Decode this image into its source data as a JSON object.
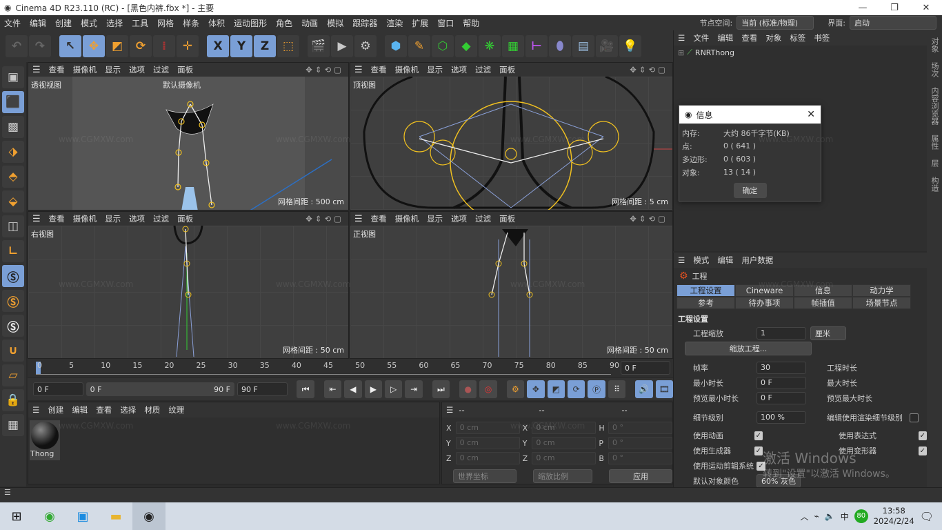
{
  "window": {
    "title": "Cinema 4D R23.110 (RC) - [黑色内裤.fbx *] - 主要",
    "controls": [
      "—",
      "❐",
      "✕"
    ]
  },
  "menu": {
    "items": [
      "文件",
      "编辑",
      "创建",
      "模式",
      "选择",
      "工具",
      "网格",
      "样条",
      "体积",
      "运动图形",
      "角色",
      "动画",
      "模拟",
      "跟踪器",
      "渲染",
      "扩展",
      "窗口",
      "帮助"
    ],
    "node_space_label": "节点空间:",
    "node_space_value": "当前 (标准/物理)",
    "layout_label": "界面:",
    "layout_value": "启动"
  },
  "toolbar": {
    "icons": [
      "undo-icon",
      "redo-icon",
      "select-icon",
      "move-icon",
      "scale-icon",
      "rotate-icon",
      "recent-icon",
      "transform-icon",
      "x-axis-icon",
      "y-axis-icon",
      "z-axis-icon",
      "coord-system-icon",
      "render-view-icon",
      "render-icon",
      "render-settings-icon",
      "cube-icon",
      "pen-icon",
      "subdivision-icon",
      "extrude-icon",
      "array-icon",
      "cloner-icon",
      "deformer-icon",
      "field-icon",
      "floor-icon",
      "camera-icon",
      "light-icon"
    ],
    "xyz": [
      "X",
      "Y",
      "Z"
    ]
  },
  "viewports": [
    {
      "menu": [
        "查看",
        "摄像机",
        "显示",
        "选项",
        "过滤",
        "面板"
      ],
      "label": "透视视图",
      "camera": "默认摄像机",
      "grid": "网格间距 : 500 cm"
    },
    {
      "menu": [
        "查看",
        "摄像机",
        "显示",
        "选项",
        "过滤",
        "面板"
      ],
      "label": "顶视图",
      "grid": "网格间距 : 5 cm"
    },
    {
      "menu": [
        "查看",
        "摄像机",
        "显示",
        "选项",
        "过滤",
        "面板"
      ],
      "label": "右视图",
      "grid": "网格间距 : 50 cm"
    },
    {
      "menu": [
        "查看",
        "摄像机",
        "显示",
        "选项",
        "过滤",
        "面板"
      ],
      "label": "正视图",
      "grid": "网格间距 : 50 cm"
    }
  ],
  "timeline": {
    "ticks": [
      "0",
      "5",
      "10",
      "15",
      "20",
      "25",
      "30",
      "35",
      "40",
      "45",
      "50",
      "55",
      "60",
      "65",
      "70",
      "75",
      "80",
      "85",
      "90"
    ],
    "current": "0 F",
    "current_frame": 0,
    "end": 90
  },
  "transport": {
    "start": "0 F",
    "range_start": "0 F",
    "range_end": "90 F",
    "end": "90 F"
  },
  "material_panel": {
    "menu": [
      "创建",
      "编辑",
      "查看",
      "选择",
      "材质",
      "纹理"
    ],
    "materials": [
      {
        "name": "Thong"
      }
    ]
  },
  "coord_panel": {
    "headers": [
      "--",
      "--",
      "--"
    ],
    "rows": [
      {
        "a": "X",
        "av": "0 cm",
        "b": "X",
        "bv": "0 cm",
        "c": "H",
        "cv": "0 °"
      },
      {
        "a": "Y",
        "av": "0 cm",
        "b": "Y",
        "bv": "0 cm",
        "c": "P",
        "cv": "0 °"
      },
      {
        "a": "Z",
        "av": "0 cm",
        "b": "Z",
        "bv": "0 cm",
        "c": "B",
        "cv": "0 °"
      }
    ],
    "mode": "世界坐标",
    "scale": "缩放比例",
    "apply": "应用"
  },
  "object_manager": {
    "menu": [
      "文件",
      "编辑",
      "查看",
      "对象",
      "标签",
      "书签"
    ],
    "objects": [
      {
        "name": "RNRThong"
      }
    ]
  },
  "info_dialog": {
    "title": "信息",
    "rows": [
      {
        "k": "内存:",
        "v": "大约 86千字节(KB)"
      },
      {
        "k": "点:",
        "v": "0 ( 641 )"
      },
      {
        "k": "多边形:",
        "v": "0 ( 603 )"
      },
      {
        "k": "对象:",
        "v": "13 ( 14 )"
      }
    ],
    "ok": "确定"
  },
  "attributes": {
    "menu": [
      "模式",
      "编辑",
      "用户数据"
    ],
    "object": "工程",
    "tabs": [
      "工程设置",
      "Cineware",
      "信息",
      "动力学",
      "参考",
      "待办事项",
      "帧插值",
      "场景节点"
    ],
    "active_tab": "工程设置",
    "section": "工程设置",
    "scale_label": "工程缩放",
    "scale_value": "1",
    "scale_unit": "厘米",
    "scale_button": "缩放工程...",
    "fps_label": "帧率",
    "fps": "30",
    "duration_label": "工程时长",
    "min_label": "最小时长",
    "min": "0 F",
    "max_label": "最大时长",
    "pmin_label": "预览最小时长",
    "pmin": "0 F",
    "pmax_label": "预览最大时长",
    "lod_label": "细节级别",
    "lod": "100 %",
    "render_lod_label": "编辑使用渲染细节级别",
    "checks": [
      {
        "l": "使用动画",
        "checked": true
      },
      {
        "l": "使用表达式",
        "checked": true
      },
      {
        "l": "使用生成器",
        "checked": true
      },
      {
        "l": "使用变形器",
        "checked": true
      },
      {
        "l": "使用运动剪辑系统",
        "checked": true
      }
    ],
    "color_label": "默认对象颜色",
    "color_value": "60% 灰色"
  },
  "right_tabs": [
    "对象",
    "场次",
    "内容浏览器",
    "属性",
    "层",
    "构造"
  ],
  "watermark": "www.CGMXW.com",
  "activation": {
    "line1": "激活 Windows",
    "line2": "转到\"设置\"以激活 Windows。"
  },
  "taskbar": {
    "ime": "中",
    "badge": "80",
    "time": "13:58",
    "date": "2024/2/24"
  },
  "colors": {
    "accent": "#7a9fd6",
    "orange": "#f0a030",
    "bg": "#2f2f2f"
  }
}
